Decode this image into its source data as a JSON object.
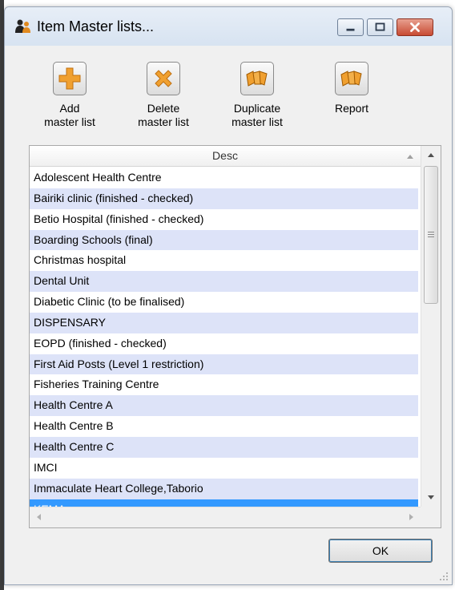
{
  "window": {
    "title": "Item Master lists...",
    "icon": "app-people-icon"
  },
  "toolbar": {
    "buttons": [
      {
        "label": "Add\nmaster list",
        "icon": "plus-icon"
      },
      {
        "label": "Delete\nmaster list",
        "icon": "x-icon"
      },
      {
        "label": "Duplicate\nmaster list",
        "icon": "cards-icon"
      },
      {
        "label": "Report",
        "icon": "cards-icon"
      }
    ]
  },
  "table": {
    "header": "Desc",
    "rows": [
      "Adolescent Health Centre",
      "Bairiki clinic (finished - checked)",
      "Betio Hospital (finished - checked)",
      "Boarding Schools (final)",
      "Christmas hospital",
      "Dental Unit",
      "Diabetic Clinic (to be finalised)",
      "DISPENSARY",
      "EOPD (finished - checked)",
      "First Aid Posts (Level 1 restriction)",
      "Fisheries Training Centre",
      "Health Centre A",
      "Health Centre B",
      "Health Centre C",
      "IMCI",
      "Immaculate Heart College,Taborio",
      "KEMA"
    ],
    "selected_index": 16
  },
  "ok_button": "OK",
  "colors": {
    "alt_row": "#dde3f8",
    "selected_row": "#3399ff",
    "icon_orange": "#f0a030"
  }
}
